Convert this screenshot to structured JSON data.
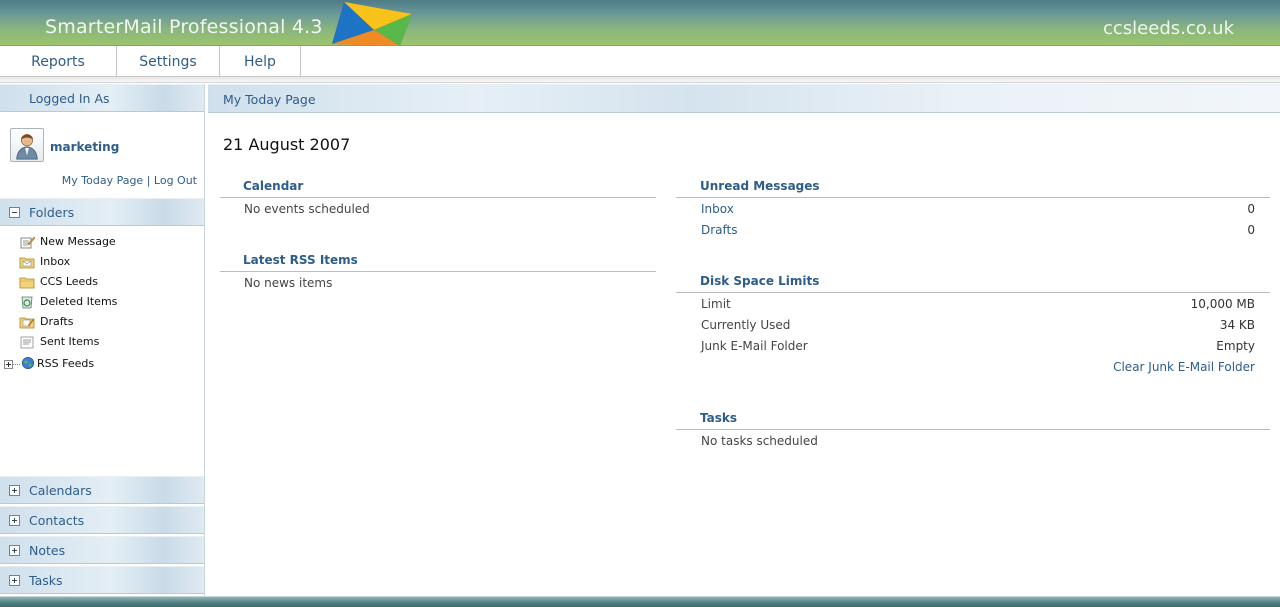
{
  "header": {
    "app_title": "SmarterMail Professional 4.3",
    "domain": "ccsleeds.co.uk"
  },
  "topnav": {
    "items": [
      {
        "label": "Reports"
      },
      {
        "label": "Settings"
      },
      {
        "label": "Help"
      }
    ]
  },
  "sidebar": {
    "logged_in_heading": "Logged In As",
    "username": "marketing",
    "link_today": "My Today Page",
    "link_separator": " | ",
    "link_logout": "Log Out",
    "folders_heading": "Folders",
    "folders": [
      {
        "label": "New Message",
        "icon": "new-message-icon"
      },
      {
        "label": "Inbox",
        "icon": "inbox-folder-icon"
      },
      {
        "label": "CCS Leeds",
        "icon": "folder-icon"
      },
      {
        "label": "Deleted Items",
        "icon": "recycle-bin-icon"
      },
      {
        "label": "Drafts",
        "icon": "drafts-folder-icon"
      },
      {
        "label": "Sent Items",
        "icon": "sent-items-icon"
      },
      {
        "label": "RSS Feeds",
        "icon": "rss-globe-icon"
      }
    ],
    "bottom_sections": [
      {
        "label": "Calendars"
      },
      {
        "label": "Contacts"
      },
      {
        "label": "Notes"
      },
      {
        "label": "Tasks"
      }
    ]
  },
  "main": {
    "heading": "My Today Page",
    "date": "21 August 2007",
    "calendar": {
      "title": "Calendar",
      "empty": "No events scheduled"
    },
    "rss": {
      "title": "Latest RSS Items",
      "empty": "No news items"
    },
    "unread": {
      "title": "Unread Messages",
      "rows": [
        {
          "label": "Inbox",
          "value": "0"
        },
        {
          "label": "Drafts",
          "value": "0"
        }
      ]
    },
    "disk": {
      "title": "Disk Space Limits",
      "rows": [
        {
          "label": "Limit",
          "value": "10,000 MB"
        },
        {
          "label": "Currently Used",
          "value": "34 KB"
        },
        {
          "label": "Junk E-Mail Folder",
          "value": "Empty"
        }
      ],
      "clear_link": "Clear Junk E-Mail Folder"
    },
    "tasks": {
      "title": "Tasks",
      "empty": "No tasks scheduled"
    }
  },
  "colors": {
    "accent": "#2e5d8a",
    "header_top": "#4d7b86",
    "header_bottom": "#9cc46d"
  }
}
